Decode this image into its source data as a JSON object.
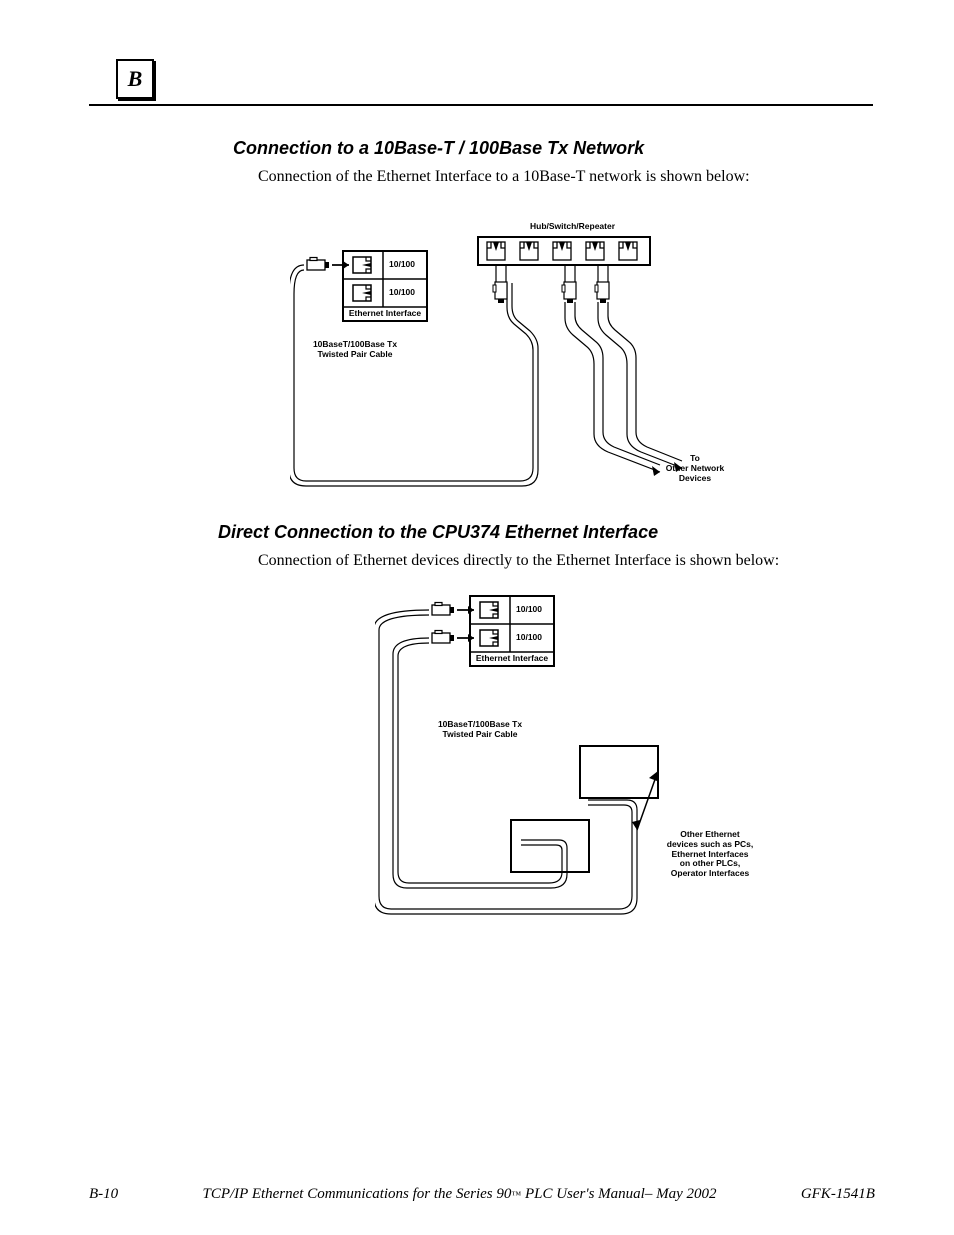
{
  "badge": "B",
  "section1": {
    "heading": "Connection to a 10Base-T / 100Base Tx Network",
    "para": "Connection of the Ethernet Interface to a 10Base-T network is shown below:"
  },
  "section2": {
    "heading": "Direct Connection to the CPU374 Ethernet Interface",
    "para": "Connection of Ethernet devices directly to the Ethernet Interface is shown below:"
  },
  "diagA": {
    "hub_label": "Hub/Switch/Repeater",
    "port1": "10/100",
    "port2": "10/100",
    "eth_if": "Ethernet Interface",
    "cable_label_l1": "10BaseT/100Base Tx",
    "cable_label_l2": "Twisted Pair Cable",
    "to_label_l1": "To",
    "to_label_l2": "Other Network",
    "to_label_l3": "Devices"
  },
  "diagB": {
    "port1": "10/100",
    "port2": "10/100",
    "eth_if": "Ethernet Interface",
    "cable_label_l1": "10BaseT/100Base Tx",
    "cable_label_l2": "Twisted Pair Cable",
    "other_l1": "Other Ethernet",
    "other_l2": "devices such as PCs,",
    "other_l3": "Ethernet Interfaces",
    "other_l4": "on other PLCs,",
    "other_l5": "Operator Interfaces"
  },
  "footer": {
    "pagenum": "B-10",
    "center_pre": "TCP/IP Ethernet Communications for the Series 90",
    "center_tm": "™",
    "center_post": " PLC User's Manual– May 2002",
    "right": "GFK-1541B"
  }
}
